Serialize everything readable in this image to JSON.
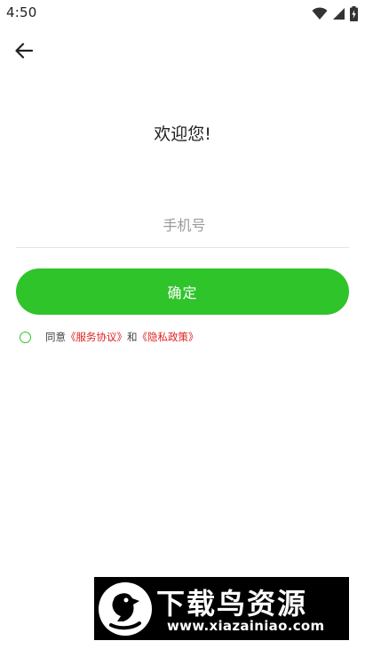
{
  "status_bar": {
    "time": "4:50",
    "icons": [
      "wifi-icon",
      "cellular-signal-icon",
      "battery-charging-icon"
    ]
  },
  "nav": {
    "back_icon": "arrow-left-icon"
  },
  "login": {
    "welcome": "欢迎您!",
    "phone_placeholder": "手机号",
    "phone_value": "",
    "confirm_label": "确定"
  },
  "agreement": {
    "checked": false,
    "prefix": "同意",
    "service_link": "《服务协议》",
    "conjunction": "和",
    "privacy_link": "《隐私政策》"
  },
  "watermark": {
    "title": "下载鸟资源",
    "url": "www.xiazainiao.com"
  },
  "colors": {
    "accent": "#2fc42a",
    "link": "#e02020",
    "background": "#ffffff"
  }
}
